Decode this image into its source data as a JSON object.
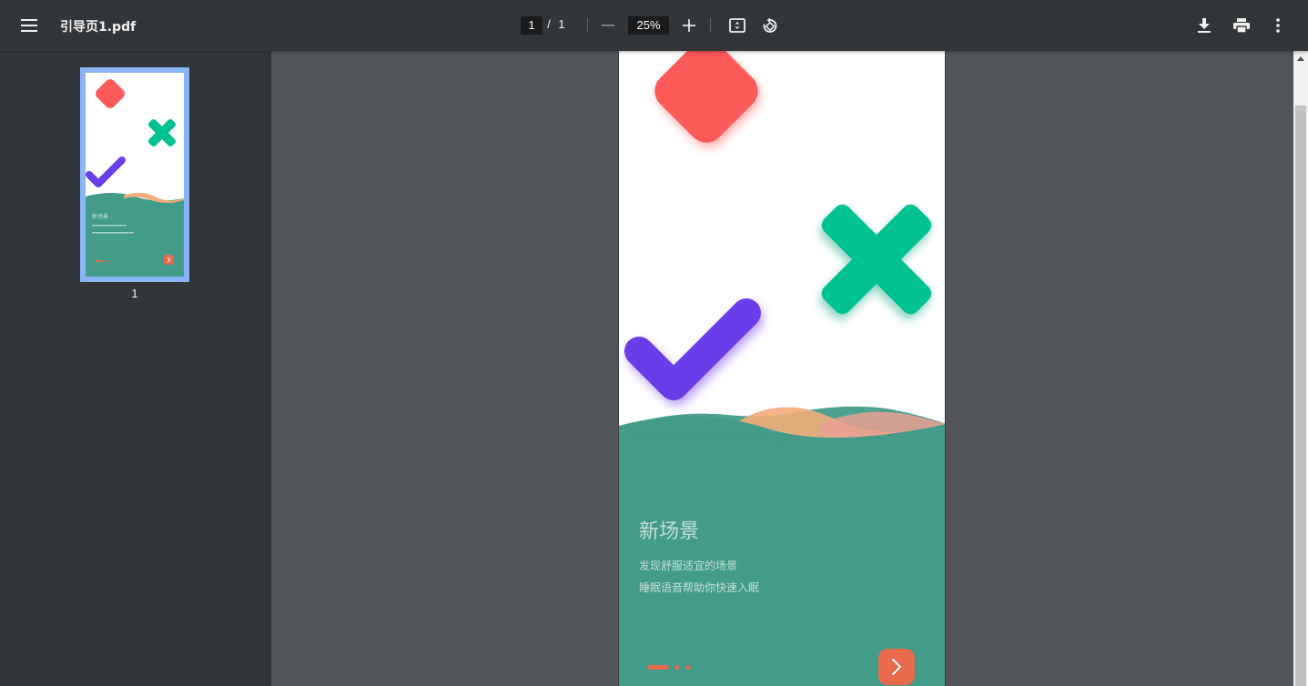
{
  "toolbar": {
    "title": "引导页1.pdf",
    "current_page": "1",
    "separator": "/",
    "total_pages": "1",
    "zoom": "25%",
    "icons": [
      "menu-icon",
      "zoom-out-icon",
      "zoom-in-icon",
      "fit-page-icon",
      "rotate-icon",
      "download-icon",
      "print-icon",
      "more-icon"
    ]
  },
  "sidebar": {
    "thumbnail_label": "1"
  },
  "document": {
    "heading": "新场景",
    "line1": "发现舒服适宜的场景",
    "line2": "睡眠语音帮助你快速入眠",
    "colors": {
      "square": "#ff5a5a",
      "cross": "#00c291",
      "check": "#6a3ee8",
      "panel": "#439c8a",
      "accent": "#e96a4c",
      "wave_orange": "#f2ad7a"
    },
    "icons": [
      "rounded-square-shape",
      "cross-shape",
      "check-shape",
      "next-arrow-icon"
    ]
  }
}
